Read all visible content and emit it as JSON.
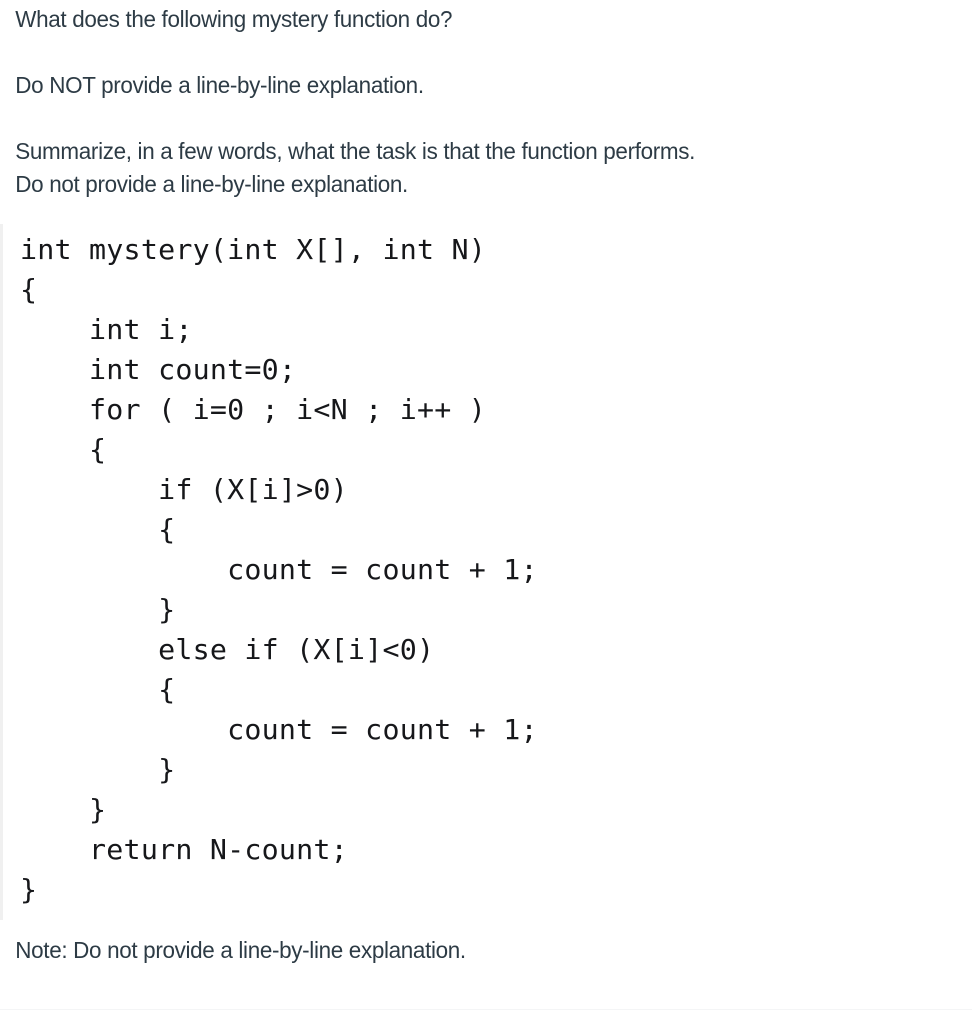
{
  "document": {
    "background_color": "#ffffff",
    "text_color": "#2d3b45",
    "code_text_color": "#16171a",
    "code_border_color": "#f0f0f0"
  },
  "prompt": {
    "line_1": "What does the following mystery function do?",
    "line_2": "Do NOT provide a line-by-line explanation.",
    "line_3": "Summarize, in a few words, what the task is that the function performs.\nDo not provide a line-by-line explanation."
  },
  "code_block": {
    "language": "c",
    "lines": [
      "int mystery(int X[], int N)",
      "{",
      "    int i;",
      "    int count=0;",
      "    for ( i=0 ; i<N ; i++ )",
      "    {",
      "        if (X[i]>0)",
      "        {",
      "            count = count + 1;",
      "        }",
      "        else if (X[i]<0)",
      "        {",
      "            count = count + 1;",
      "        }",
      "    }",
      "    return N-count;",
      "}"
    ],
    "text": "int mystery(int X[], int N)\n{\n    int i;\n    int count=0;\n    for ( i=0 ; i<N ; i++ )\n    {\n        if (X[i]>0)\n        {\n            count = count + 1;\n        }\n        else if (X[i]<0)\n        {\n            count = count + 1;\n        }\n    }\n    return N-count;\n}"
  },
  "note": {
    "text": "Note: Do not provide a line-by-line explanation."
  }
}
